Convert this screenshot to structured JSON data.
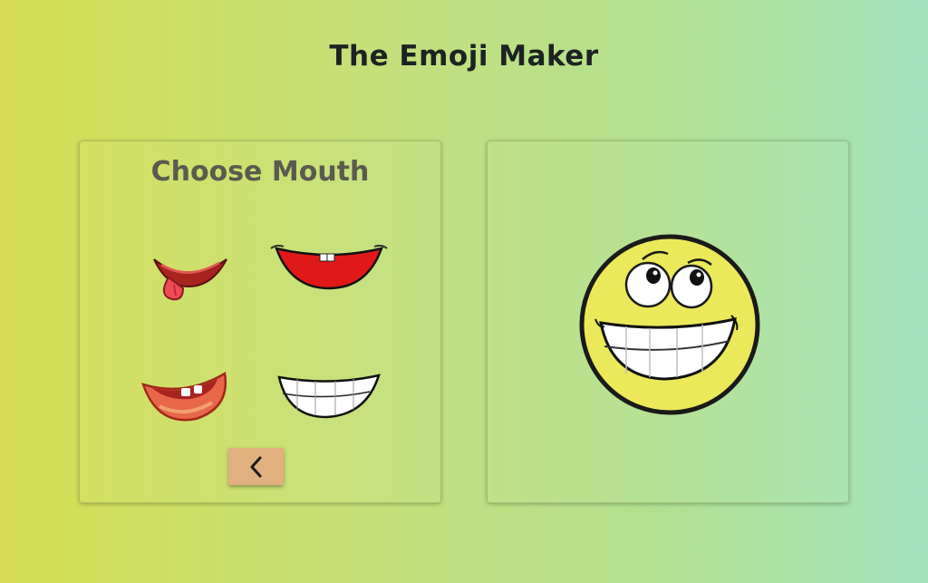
{
  "app": {
    "title": "The Emoji Maker"
  },
  "picker": {
    "heading": "Choose Mouth",
    "options": [
      {
        "name": "tongue-out"
      },
      {
        "name": "smile-teeth"
      },
      {
        "name": "open-laugh"
      },
      {
        "name": "grin"
      }
    ],
    "back_icon": "chevron-left-icon"
  },
  "preview": {
    "face_color": "#ebe95a",
    "eyes": "looking-up",
    "mouth": "grin"
  },
  "colors": {
    "panel_border": "#8a9a5a",
    "back_button": "#e0b07f",
    "title_text": "#1c2322",
    "heading_text": "#5a5a4e"
  }
}
